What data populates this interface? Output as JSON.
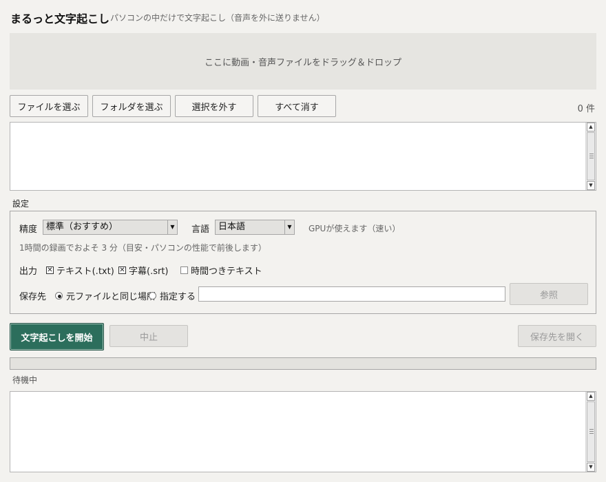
{
  "app": {
    "title": "まるっと文字起こし",
    "subtitle": "パソコンの中だけで文字起こし（音声を外に送りません）"
  },
  "dropzone": {
    "text": "ここに動画・音声ファイルをドラッグ＆ドロップ"
  },
  "file_toolbar": {
    "choose_file": "ファイルを選ぶ",
    "choose_folder": "フォルダを選ぶ",
    "deselect": "選択を外す",
    "clear_all": "すべて消す",
    "count": "0 件"
  },
  "file_list": {
    "items": []
  },
  "settings": {
    "section_label": "設定",
    "accuracy_label": "精度",
    "accuracy_value": "標準（おすすめ）",
    "language_label": "言語",
    "language_value": "日本語",
    "gpu_status": "GPUが使えます（速い）",
    "estimate": "1時間の録画でおよそ 3 分（目安・パソコンの性能で前後します）",
    "output_label": "出力",
    "outputs": [
      {
        "label": "テキスト(.txt)",
        "checked": true
      },
      {
        "label": "字幕(.srt)",
        "checked": true
      },
      {
        "label": "時間つきテキスト",
        "checked": false
      }
    ],
    "save_label": "保存先",
    "save_options": [
      {
        "label": "元ファイルと同じ場所",
        "selected": true
      },
      {
        "label": "指定する",
        "selected": false
      }
    ],
    "save_path": "",
    "browse": "参照"
  },
  "actions": {
    "start": "文字起こしを開始",
    "stop": "中止",
    "open_folder": "保存先を開く"
  },
  "progress": {
    "value": 0
  },
  "status": {
    "text": "待機中"
  },
  "log": {
    "text": ""
  },
  "colors": {
    "primary": "#2c6e5c",
    "background": "#f3f2ef"
  }
}
